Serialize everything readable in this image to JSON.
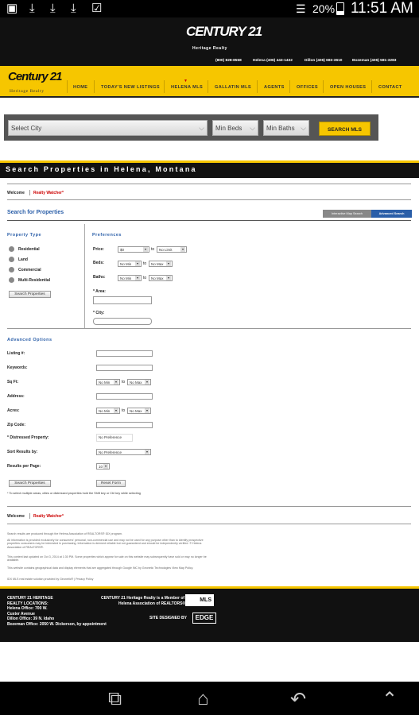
{
  "status": {
    "battery": "20%",
    "time": "11:51 AM"
  },
  "header": {
    "brand": "CENTURY 21",
    "brand_sub": "Heritage Realty",
    "phones": [
      "(800) 828-8558",
      "Helena (406) 443-1432",
      "Dillon (406) 683-3610",
      "Bozeman (406) 581-3283"
    ]
  },
  "nav": {
    "logo": "Century 21",
    "logo_sub": "Heritage Realty",
    "items": [
      "HOME",
      "TODAY'S NEW LISTINGS",
      "HELENA MLS",
      "GALLATIN MLS",
      "AGENTS",
      "OFFICES",
      "OPEN HOUSES",
      "CONTACT"
    ]
  },
  "quick_search": {
    "city": "Select City",
    "beds": "Min Beds",
    "baths": "Min Baths",
    "button": "SEARCH MLS"
  },
  "title": "Search Properties in Helena, Montana",
  "welcome": {
    "label": "Welcome",
    "link": "Realty Watcher*"
  },
  "search": {
    "heading": "Search for Properties",
    "tabs": [
      "Interactive Map Search",
      "Advanced Search"
    ],
    "property_type": {
      "heading": "Property Type",
      "options": [
        "Residential",
        "Land",
        "Commercial",
        "Multi-Residential"
      ],
      "button": "Search Properties"
    },
    "preferences": {
      "heading": "Preferences",
      "price_label": "Price:",
      "price_min": "$0",
      "to": "to",
      "price_max": "No Limit",
      "beds_label": "Beds:",
      "beds_min": "No Min",
      "beds_max": "No Max",
      "baths_label": "Baths:",
      "baths_min": "No Min",
      "baths_max": "No Max",
      "area_label": "* Area:",
      "city_label": "* City:"
    }
  },
  "advanced": {
    "heading": "Advanced Options",
    "listing_label": "Listing #:",
    "keywords_label": "Keywords:",
    "sqft_label": "Sq Ft:",
    "sqft_min": "No Min",
    "sqft_max": "No Max",
    "address_label": "Address:",
    "acres_label": "Acres:",
    "acres_min": "No Min",
    "acres_max": "No Max",
    "zip_label": "Zip Code:",
    "distressed_label": "* Distressed Property:",
    "distressed_value": "No Preference",
    "sort_label": "Sort Results by:",
    "sort_value": "No Preference",
    "results_label": "Results per Page:",
    "results_value": "10",
    "search_button": "Search Properties",
    "reset_button": "Reset Form",
    "note": "* To select multiple areas, cities or distressed properties hold the Shift key or Ctrl key while selecting"
  },
  "disclaimers": [
    "Search results are produced through the Helena Association of REALTORS® IDX program.",
    "All information is provided exclusively for consumers' personal, non-commercial use and may not be used for any purpose other than to identify prospective properties consumers may be interested in purchasing. Information is deemed reliable but not guaranteed and should be independently verified. © Helena Association of REALTORS®.",
    "This content last updated on Oct 3, 2014 at 1:30 PM. Some properties which appear for sale on this website may subsequently have sold or may no longer be available.",
    "This website contains geographical data and display elements that are aggregated through Google INC by Geonetic Technologies View Map Policy.",
    "IDX MLS real estate solution provided by Geonetic® | Privacy Policy"
  ],
  "footer": {
    "locations": [
      "CENTURY 21 HERITAGE",
      "REALTY LOCATIONS:",
      "Helena Office: 700 W.",
      "Custer Avenue",
      "Dillon Office: 39 N. Idaho",
      "Bozeman Office: 2050 W. Dickerson, by appointment"
    ],
    "member": [
      "CENTURY 21 Heritage Realty is a Member of",
      "Helena Association of REALTORS®"
    ],
    "mls": "MLS",
    "designed_by": "SITE DESIGNED BY",
    "edge": "EDGE"
  }
}
